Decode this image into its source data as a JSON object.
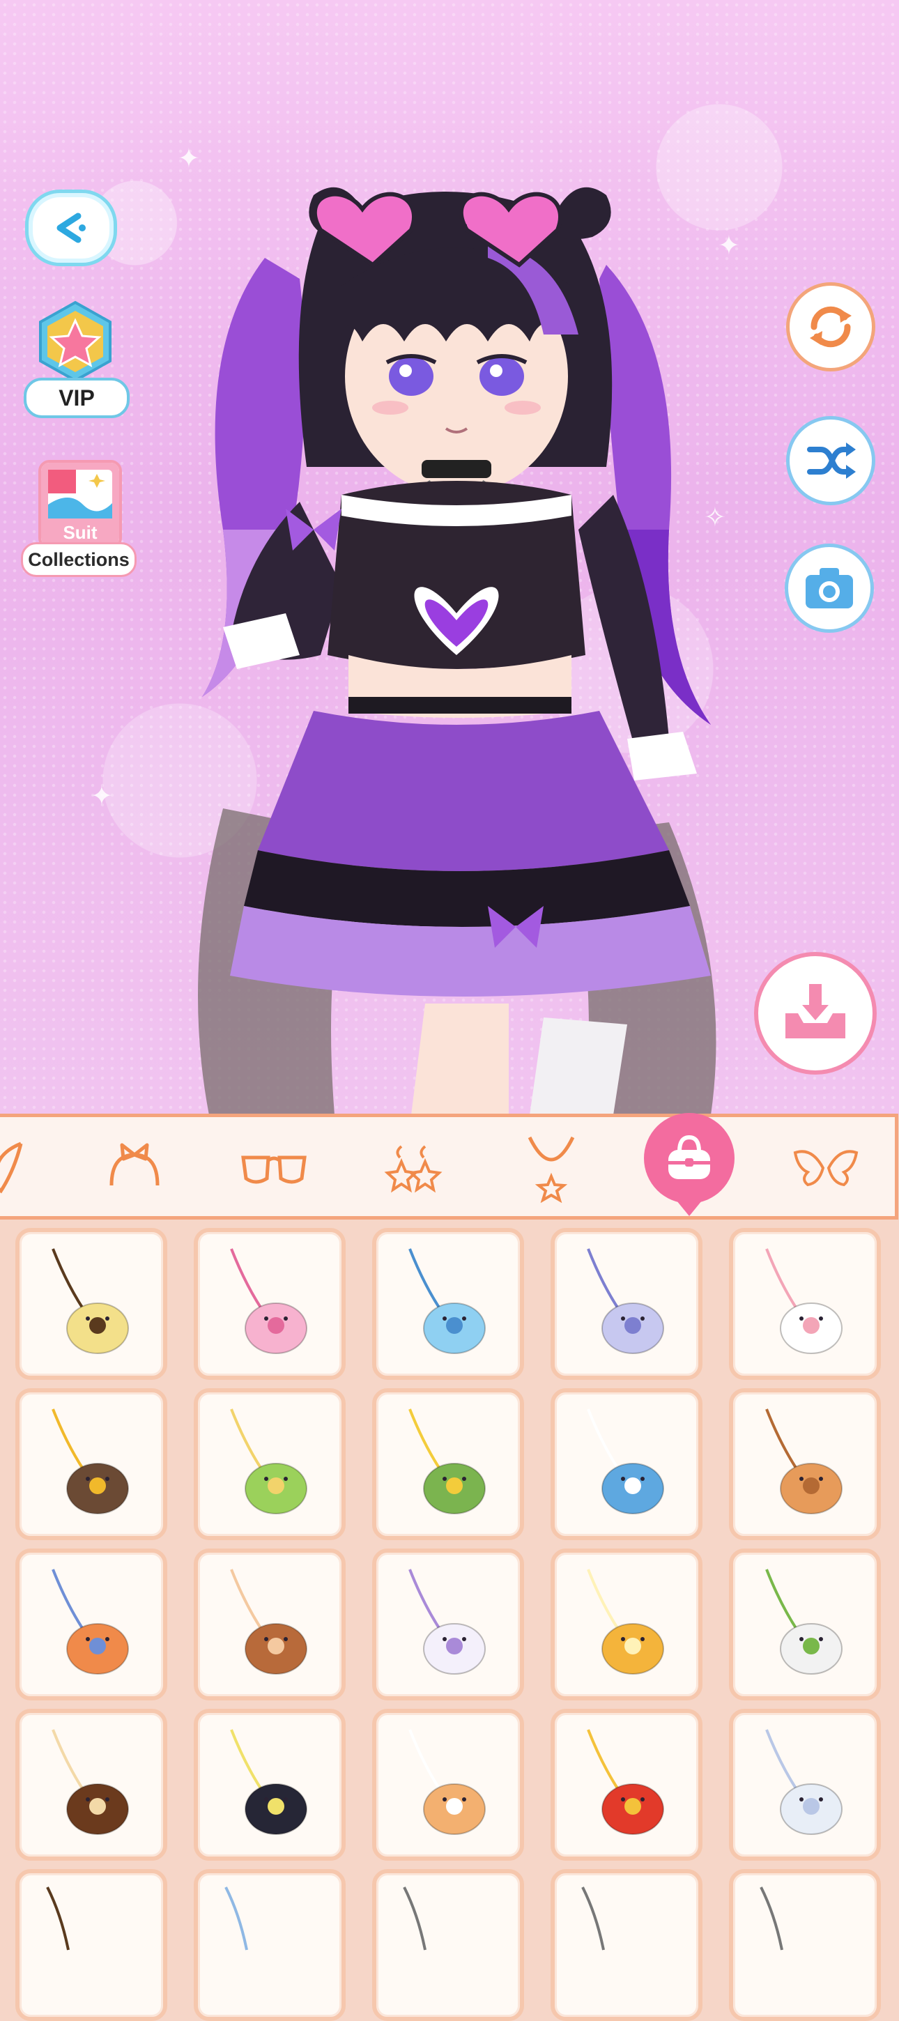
{
  "left_menu": {
    "vip_label": "VIP",
    "suit_label": "Suit",
    "collections_label": "Collections"
  },
  "categories": [
    {
      "name": "hair-accessory",
      "icon": "feather-icon",
      "active": false
    },
    {
      "name": "headband",
      "icon": "headband-icon",
      "active": false
    },
    {
      "name": "glasses",
      "icon": "glasses-icon",
      "active": false
    },
    {
      "name": "earrings",
      "icon": "earrings-icon",
      "active": false
    },
    {
      "name": "necklace",
      "icon": "necklace-icon",
      "active": false
    },
    {
      "name": "bag",
      "icon": "handbag-icon",
      "active": true
    },
    {
      "name": "wings",
      "icon": "wings-icon",
      "active": false
    }
  ],
  "items": [
    {
      "icon": "biscuit-bag-icon",
      "color": "#f3e08a",
      "accent": "#5a3a1e"
    },
    {
      "icon": "pink-pig-bag-icon",
      "color": "#f7b2cf",
      "accent": "#e46a9c"
    },
    {
      "icon": "blue-whale-bag-icon",
      "color": "#8fd0f2",
      "accent": "#4a8fcf"
    },
    {
      "icon": "lilac-monster-bag-icon",
      "color": "#c7c8f0",
      "accent": "#7d7fd0"
    },
    {
      "icon": "cat-paw-bag-icon",
      "color": "#ffffff",
      "accent": "#f3a5b7"
    },
    {
      "icon": "sunflower-tote-icon",
      "color": "#6b4a34",
      "accent": "#f1b92b"
    },
    {
      "icon": "monkey-bag-icon",
      "color": "#9bd15b",
      "accent": "#f2d36b"
    },
    {
      "icon": "cactus-chick-bag-icon",
      "color": "#7bb44f",
      "accent": "#f3cc3b"
    },
    {
      "icon": "shark-bag-icon",
      "color": "#5ea8e0",
      "accent": "#ffffff"
    },
    {
      "icon": "wood-plank-bag-icon",
      "color": "#e79b5a",
      "accent": "#b46a34"
    },
    {
      "icon": "orange-cat-fish-bag-icon",
      "color": "#f08a4a",
      "accent": "#6f8fd6"
    },
    {
      "icon": "capybara-bag-icon",
      "color": "#b86a3a",
      "accent": "#f4c9a0"
    },
    {
      "icon": "white-bunny-bag-icon",
      "color": "#f4f0fb",
      "accent": "#a98ad8"
    },
    {
      "icon": "lemon-slice-bag-icon",
      "color": "#f4b43b",
      "accent": "#fff2b8"
    },
    {
      "icon": "eyeball-bag-icon",
      "color": "#f2f2f2",
      "accent": "#79b84a"
    },
    {
      "icon": "cookie-bag-icon",
      "color": "#6b3a1d",
      "accent": "#f3d9a8"
    },
    {
      "icon": "black-cat-bag-icon",
      "color": "#262636",
      "accent": "#f0e16a"
    },
    {
      "icon": "hamster-bag-icon",
      "color": "#f3b070",
      "accent": "#ffffff"
    },
    {
      "icon": "fries-bag-icon",
      "color": "#e23a2a",
      "accent": "#f4c23b"
    },
    {
      "icon": "pearl-shell-bag-icon",
      "color": "#e8eef7",
      "accent": "#b9c7e6"
    },
    {
      "icon": "partial-item-icon",
      "color": "#f3e08a",
      "accent": "#5a3a1e"
    },
    {
      "icon": "partial-bunny-item-icon",
      "color": "#cfe6f8",
      "accent": "#8fb8e4"
    },
    {
      "icon": "partial-item-icon",
      "color": "#333333",
      "accent": "#777777"
    },
    {
      "icon": "partial-item-icon",
      "color": "#333333",
      "accent": "#777777"
    },
    {
      "icon": "partial-item-icon",
      "color": "#333333",
      "accent": "#777777"
    }
  ],
  "colors": {
    "accent_pink": "#f36c9f",
    "tile_border": "#f6c7ad",
    "panel_bg": "#f6d6c8",
    "outline_orange": "#f4a47d"
  }
}
